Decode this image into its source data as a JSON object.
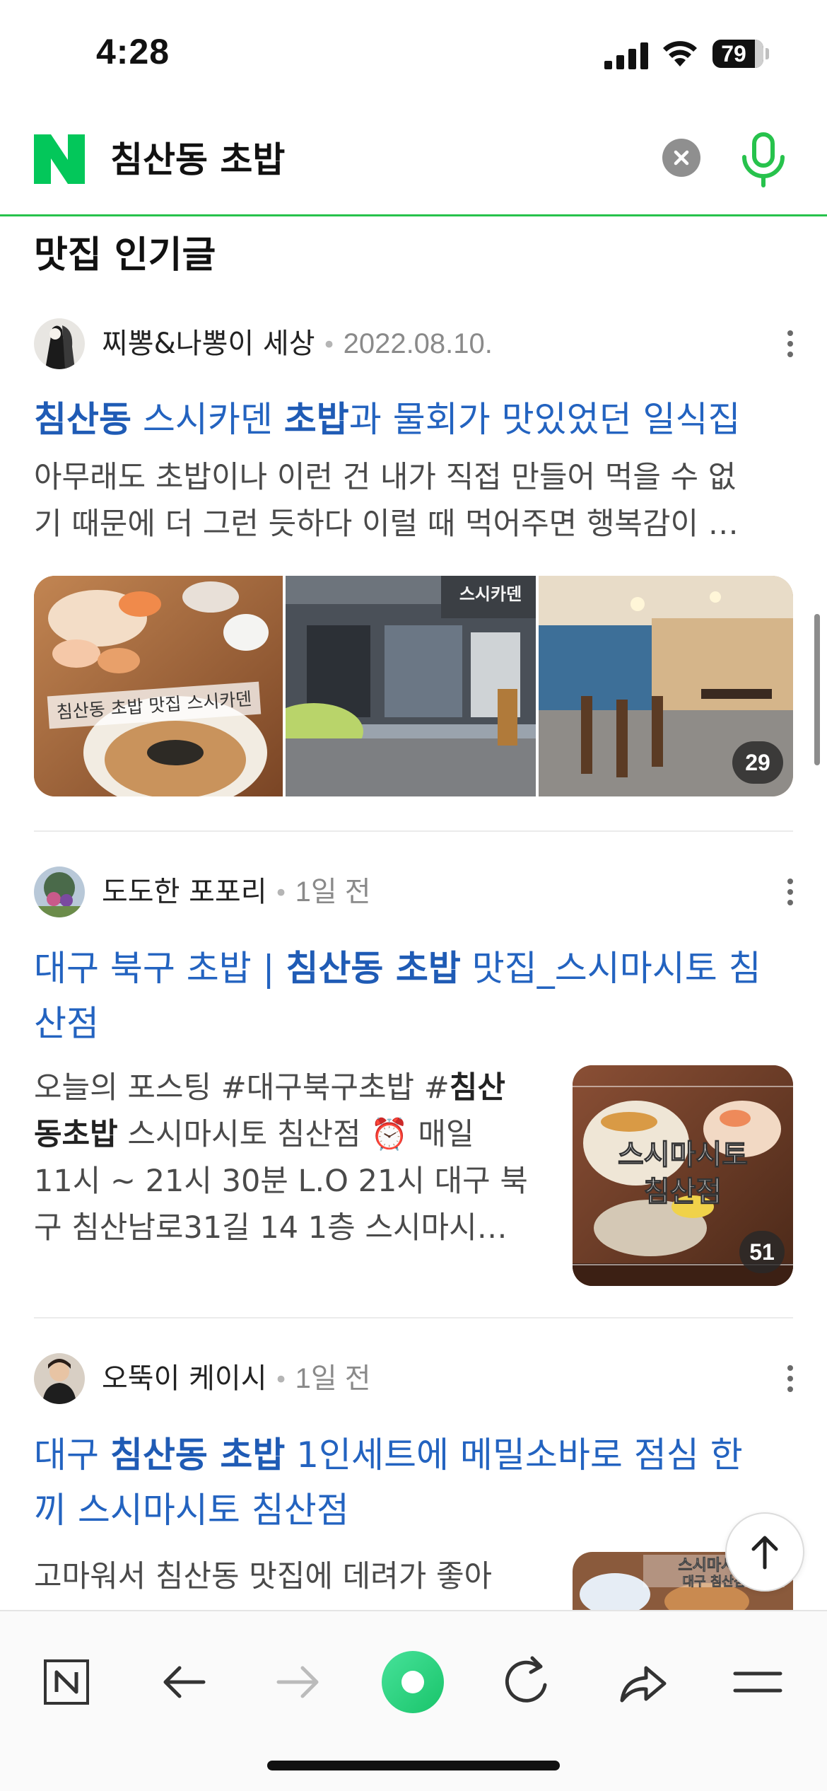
{
  "status_bar": {
    "time": "4:28",
    "battery": "79"
  },
  "search": {
    "query": "침산동 초밥",
    "logo": "naver-n-logo"
  },
  "section": {
    "title": "맛집 인기글"
  },
  "posts": [
    {
      "author": "찌뽕&나뽕이 세상",
      "date": "2022.08.10.",
      "title": [
        {
          "t": "침산동",
          "b": true
        },
        {
          "t": " 스시카덴 ",
          "b": false
        },
        {
          "t": "초밥",
          "b": true
        },
        {
          "t": "과 물회가 맛있었던 일식집",
          "b": false
        }
      ],
      "snippet_lines": [
        [
          {
            "t": "아무래도 초밥이나 이런 건 내가 직접 만들어 먹을 수 없",
            "b": false
          }
        ],
        [
          {
            "t": "기 때문에 더 그런 듯하다 이럴 때 먹어주면 행복감이 …",
            "b": false
          }
        ]
      ],
      "photo_caption": "침산동 초밥 맛집 스시카덴",
      "photo_sign": "스시카덴",
      "photo_count": "29"
    },
    {
      "author": "도도한 포포리",
      "date": "1일 전",
      "title": [
        {
          "t": "대구 북구 초밥 | ",
          "b": false
        },
        {
          "t": "침산동 초밥",
          "b": true
        },
        {
          "t": " 맛집_스시마시토 침",
          "b": false
        },
        {
          "t": "\n산점",
          "b": false
        }
      ],
      "snippet_lines": [
        [
          {
            "t": "오늘의 포스팅 #대구북구초밥 #",
            "b": false
          },
          {
            "t": "침산",
            "b": true
          }
        ],
        [
          {
            "t": "동초밥",
            "b": true
          },
          {
            "t": " 스시마시토 침산점 ⏰ 매일",
            "b": false
          }
        ],
        [
          {
            "t": "11시 ~ 21시 30분 L.O 21시 대구 북",
            "b": false
          }
        ],
        [
          {
            "t": "구 침산남로31길 14 1층 스시마시…",
            "b": false
          }
        ]
      ],
      "thumb_caption_1": "스시마시토",
      "thumb_caption_2": "침산점",
      "photo_count": "51"
    },
    {
      "author": "오뚝이 케이시",
      "date": "1일 전",
      "title": [
        {
          "t": "대구 ",
          "b": false
        },
        {
          "t": "침산동 초밥",
          "b": true
        },
        {
          "t": " 1인세트에 메밀소바로 점심 한",
          "b": false
        },
        {
          "t": "\n끼 스시마시토 침산점",
          "b": false
        }
      ],
      "snippet_lines": [
        [
          {
            "t": "고마워서 침산동 맛집에 데려가 좋아",
            "b": false
          }
        ]
      ],
      "thumb_caption_1": "스시마시토",
      "thumb_caption_2": "대구 침산점"
    }
  ],
  "toolbar": {
    "items": [
      "naver-home-icon",
      "back-arrow-icon",
      "forward-arrow-icon",
      "green-dot-icon",
      "refresh-icon",
      "share-icon",
      "menu-icon"
    ]
  },
  "colors": {
    "accent_green": "#27c24c",
    "link_blue": "#2363c0",
    "naver_green": "#03c75a"
  }
}
